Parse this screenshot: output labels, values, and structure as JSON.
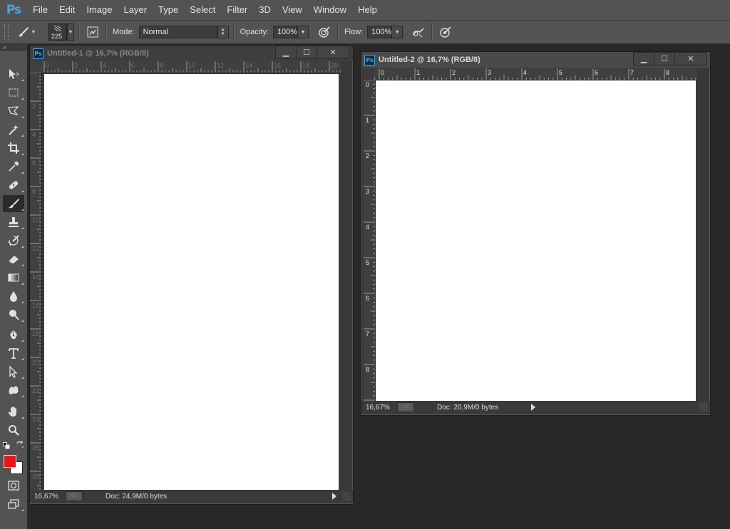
{
  "app": {
    "logo": "Ps",
    "menu": [
      "File",
      "Edit",
      "Image",
      "Layer",
      "Type",
      "Select",
      "Filter",
      "3D",
      "View",
      "Window",
      "Help"
    ]
  },
  "options": {
    "brush_size": "225",
    "mode_label": "Mode:",
    "mode_value": "Normal",
    "opacity_label": "Opacity:",
    "opacity_value": "100%",
    "flow_label": "Flow:",
    "flow_value": "100%"
  },
  "toolbar": {
    "collapse": "»",
    "tools": [
      "move",
      "rectangular-marquee",
      "lasso",
      "magic-wand",
      "crop",
      "eyedropper",
      "healing-brush",
      "brush",
      "clone-stamp",
      "history-brush",
      "eraser",
      "gradient",
      "blur",
      "dodge",
      "pen",
      "type",
      "path-selection",
      "custom-shape",
      "hand",
      "zoom"
    ],
    "active_tool": "brush",
    "foreground_color": "#e8151b",
    "background_color": "#ffffff"
  },
  "documents": [
    {
      "title": "Untitled-1 @ 16,7% (RGB/8)",
      "zoom": "16,67%",
      "doc_info": "Doc: 24,9M/0 bytes",
      "ruler_h": [
        "0",
        "2",
        "4",
        "6",
        "8",
        "10",
        "12",
        "14",
        "16",
        "18",
        "20"
      ],
      "ruler_v": [
        "2",
        "4",
        "6",
        "8",
        "10",
        "12",
        "14",
        "16",
        "18",
        "20",
        "22",
        "24",
        "26",
        "28"
      ],
      "active": false
    },
    {
      "title": "Untitled-2 @ 16,7% (RGB/8)",
      "zoom": "16,67%",
      "doc_info": "Doc: 20,9M/0 bytes",
      "ruler_h": [
        "0",
        "1",
        "2",
        "3",
        "4",
        "5",
        "6",
        "7",
        "8"
      ],
      "ruler_v": [
        "0",
        "1",
        "2",
        "3",
        "4",
        "5",
        "6",
        "7",
        "8"
      ],
      "active": true
    }
  ],
  "window_buttons": {
    "minimize": "▁",
    "maximize": "☐",
    "close": "✕"
  }
}
